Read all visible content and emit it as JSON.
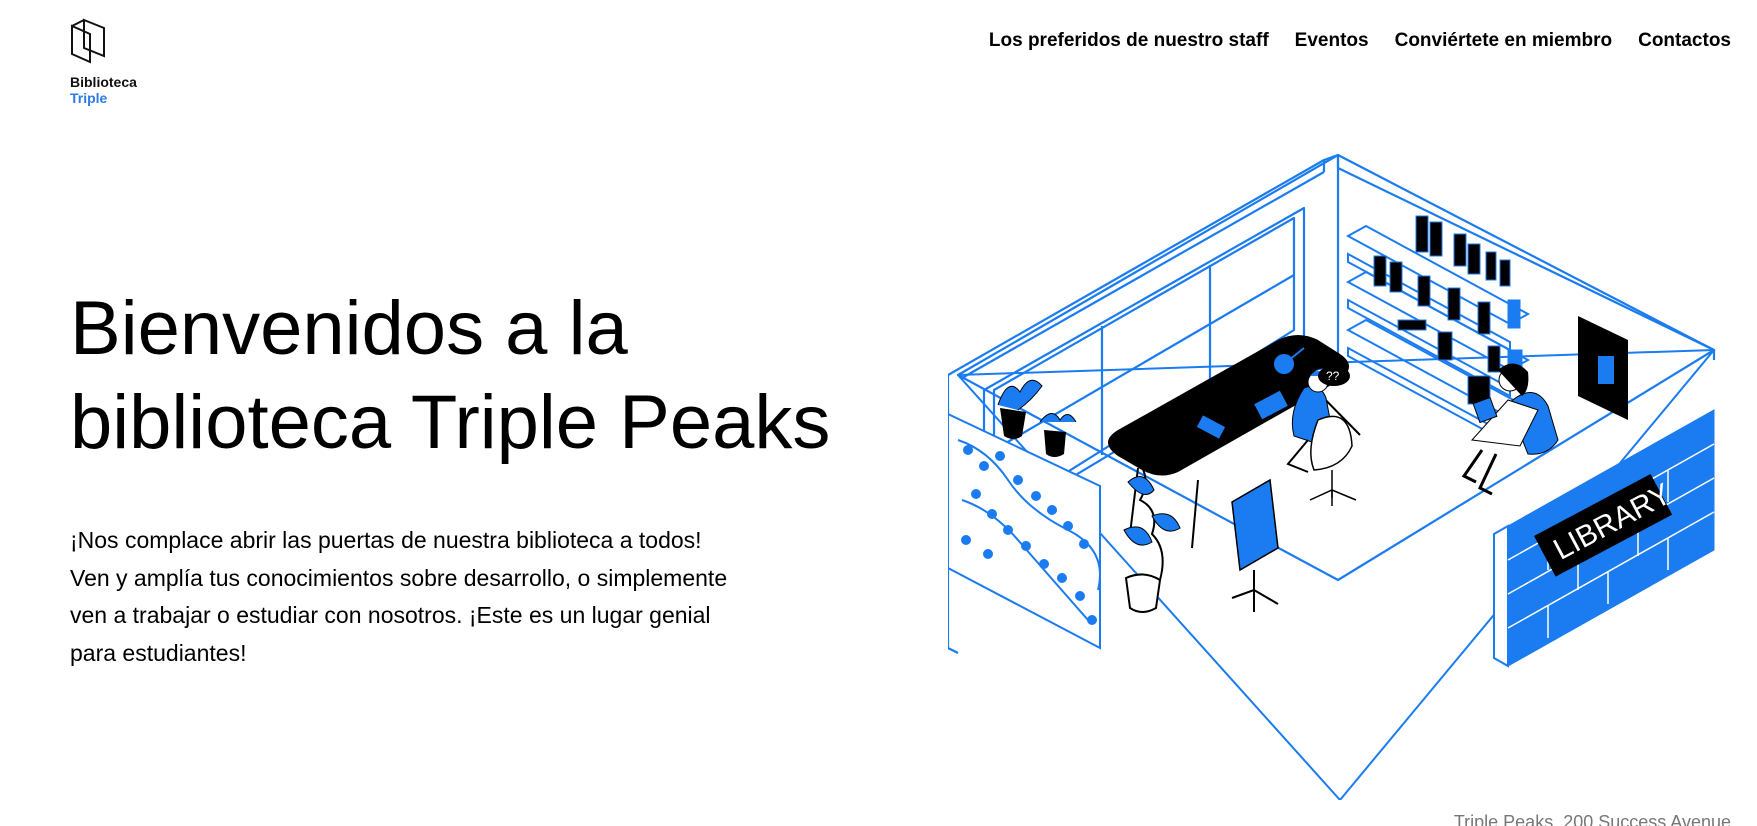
{
  "logo": {
    "line1": "Biblioteca",
    "line2": "Triple"
  },
  "nav": {
    "items": [
      {
        "label": "Los preferidos de nuestro staff"
      },
      {
        "label": "Eventos"
      },
      {
        "label": "Conviértete en miembro"
      },
      {
        "label": "Contactos"
      }
    ]
  },
  "hero": {
    "title_line1": "Bienvenidos a la",
    "title_line2": "biblioteca Triple Peaks",
    "description": "¡Nos complace abrir las puertas de nuestra biblioteca a todos! Ven y amplía tus conocimientos sobre desarrollo, o simplemente ven a trabajar o estudiar con nosotros. ¡Este es un lugar genial para estudiantes!"
  },
  "illustration": {
    "sign_text": "LIBRARY"
  },
  "footer": {
    "address": "Triple Peaks, 200 Success Avenue"
  },
  "colors": {
    "accent": "#1a7cf0",
    "logo_accent": "#2d7ce5",
    "text": "#000000",
    "muted": "#777777"
  }
}
